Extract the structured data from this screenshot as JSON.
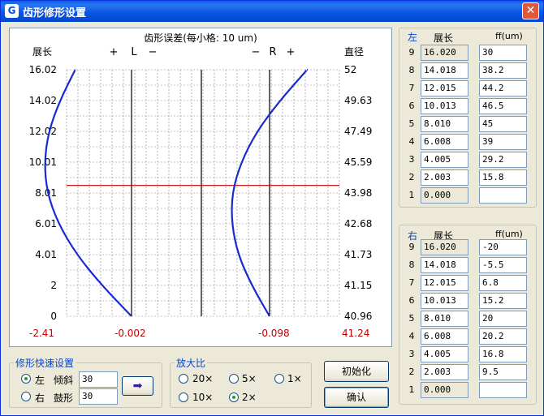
{
  "window": {
    "title": "齿形修形设置",
    "close_glyph": "✕",
    "icon_glyph": "G"
  },
  "chart": {
    "title": "齿形误差(每小格: 10 um)",
    "left_axis_title": "展长",
    "right_axis_title": "直径",
    "left_ticks": [
      "16.02",
      "14.02",
      "12.02",
      "10.01",
      "8.01",
      "6.01",
      "4.01",
      "2",
      "0"
    ],
    "right_ticks": [
      "52",
      "49.63",
      "47.49",
      "45.59",
      "43.98",
      "42.68",
      "41.73",
      "41.15",
      "40.96"
    ],
    "left_marker": {
      "plus": "+",
      "letter": "L",
      "minus": "−"
    },
    "right_marker": {
      "minus": "−",
      "letter": "R",
      "plus": "+"
    },
    "bottom_values": {
      "v1": "-2.41",
      "v2": "-0.002",
      "v3": "-0.098",
      "v4": "41.24"
    },
    "colors": {
      "curve": "#1a2ad0",
      "hline": "#c00000",
      "bottom_values": "#c00000",
      "grid": "#888888"
    }
  },
  "chart_data": {
    "type": "line",
    "title": "齿形误差(每小格: 10 um)",
    "ylabel": "展长",
    "y2label": "直径",
    "ylim": [
      0,
      16.02
    ],
    "y_ticks": [
      16.02,
      14.02,
      12.02,
      10.01,
      8.01,
      6.01,
      4.01,
      2,
      0
    ],
    "y2_ticks": [
      52,
      49.63,
      47.49,
      45.59,
      43.98,
      42.68,
      41.73,
      41.15,
      40.96
    ],
    "grid_unit_um": 10,
    "horizontal_line_y": 8.5,
    "series": [
      {
        "name": "左",
        "y": [
          0,
          2.003,
          4.005,
          6.008,
          8.01,
          10.013,
          12.015,
          14.018,
          16.02
        ],
        "ff": [
          0,
          15.8,
          29.2,
          39,
          45,
          46.5,
          44.2,
          38.2,
          30
        ]
      },
      {
        "name": "右",
        "y": [
          0,
          2.003,
          4.005,
          6.008,
          8.01,
          10.013,
          12.015,
          14.018,
          16.02
        ],
        "ff": [
          0,
          9.5,
          16.8,
          20.2,
          20,
          15.2,
          6.8,
          -5.5,
          -20
        ]
      }
    ]
  },
  "left_table": {
    "side": "左",
    "col1": "展长",
    "col2": "ff(um)",
    "rows": [
      {
        "idx": "9",
        "len": "16.020",
        "ff": "30"
      },
      {
        "idx": "8",
        "len": "14.018",
        "ff": "38.2"
      },
      {
        "idx": "7",
        "len": "12.015",
        "ff": "44.2"
      },
      {
        "idx": "6",
        "len": "10.013",
        "ff": "46.5"
      },
      {
        "idx": "5",
        "len": "8.010",
        "ff": "45"
      },
      {
        "idx": "4",
        "len": "6.008",
        "ff": "39"
      },
      {
        "idx": "3",
        "len": "4.005",
        "ff": "29.2"
      },
      {
        "idx": "2",
        "len": "2.003",
        "ff": "15.8"
      },
      {
        "idx": "1",
        "len": "0.000",
        "ff": ""
      }
    ]
  },
  "right_table": {
    "side": "右",
    "col1": "展长",
    "col2": "ff(um)",
    "rows": [
      {
        "idx": "9",
        "len": "16.020",
        "ff": "-20"
      },
      {
        "idx": "8",
        "len": "14.018",
        "ff": "-5.5"
      },
      {
        "idx": "7",
        "len": "12.015",
        "ff": "6.8"
      },
      {
        "idx": "6",
        "len": "10.013",
        "ff": "15.2"
      },
      {
        "idx": "5",
        "len": "8.010",
        "ff": "20"
      },
      {
        "idx": "4",
        "len": "6.008",
        "ff": "20.2"
      },
      {
        "idx": "3",
        "len": "4.005",
        "ff": "16.8"
      },
      {
        "idx": "2",
        "len": "2.003",
        "ff": "9.5"
      },
      {
        "idx": "1",
        "len": "0.000",
        "ff": ""
      }
    ]
  },
  "quick": {
    "group_label": "修形快速设置",
    "left_label": "左",
    "right_label": "右",
    "tilt_label": "倾斜",
    "crown_label": "鼓形",
    "tilt_value": "30",
    "crown_value": "30",
    "apply_glyph": "➡"
  },
  "zoom": {
    "group_label": "放大比",
    "options": [
      "20×",
      "5×",
      "1×",
      "10×",
      "2×"
    ],
    "selected": "2×"
  },
  "buttons": {
    "init": "初始化",
    "ok": "确认"
  }
}
